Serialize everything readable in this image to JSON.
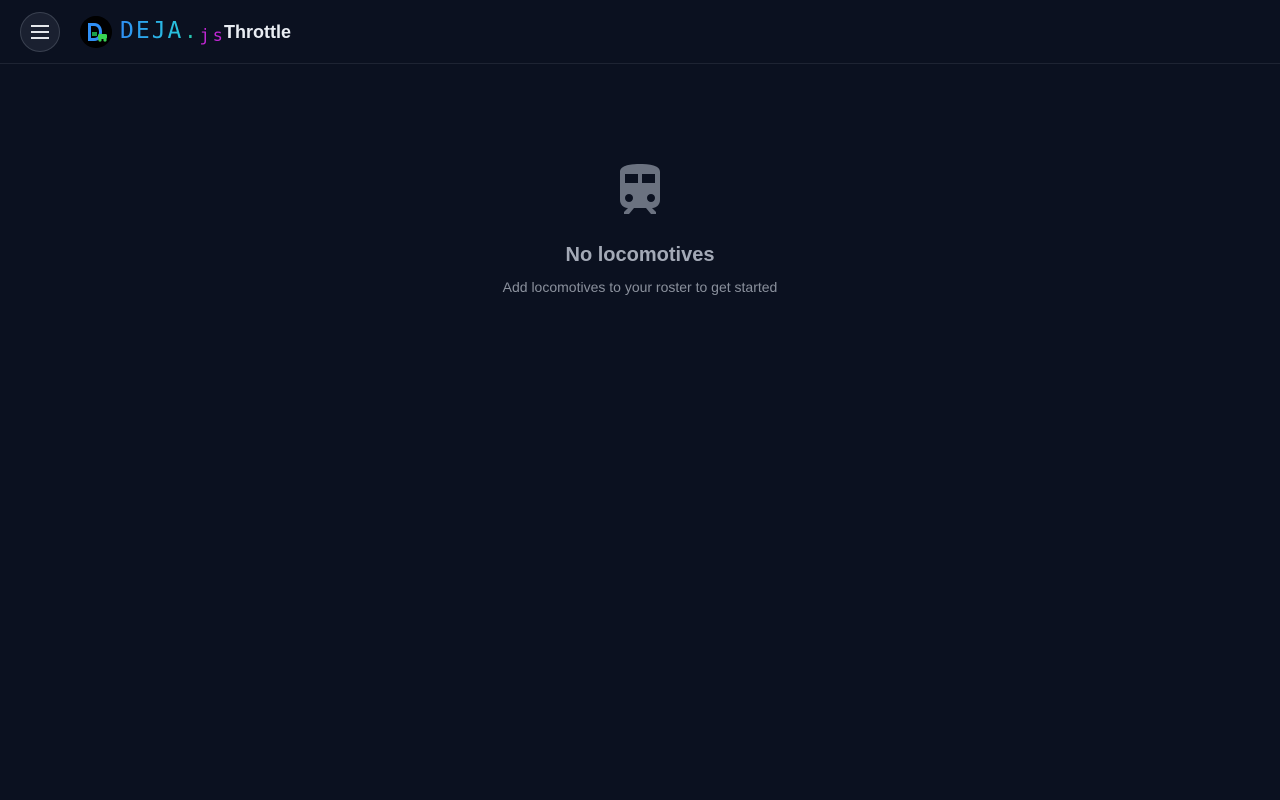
{
  "header": {
    "menu_icon": "hamburger-menu-icon",
    "logo_icon": "deja-logo-icon",
    "brand": {
      "main": "DEJA",
      "dot": ".",
      "suffix": "js"
    },
    "title": "Throttle"
  },
  "empty_state": {
    "icon": "train-icon",
    "title": "No locomotives",
    "subtitle": "Add locomotives to your roster to get started"
  },
  "colors": {
    "background": "#0b1120",
    "brand_blue": "#2f8ff5",
    "brand_cyan": "#27c6d9",
    "brand_magenta": "#c026d3",
    "muted_icon": "#6b7280"
  }
}
